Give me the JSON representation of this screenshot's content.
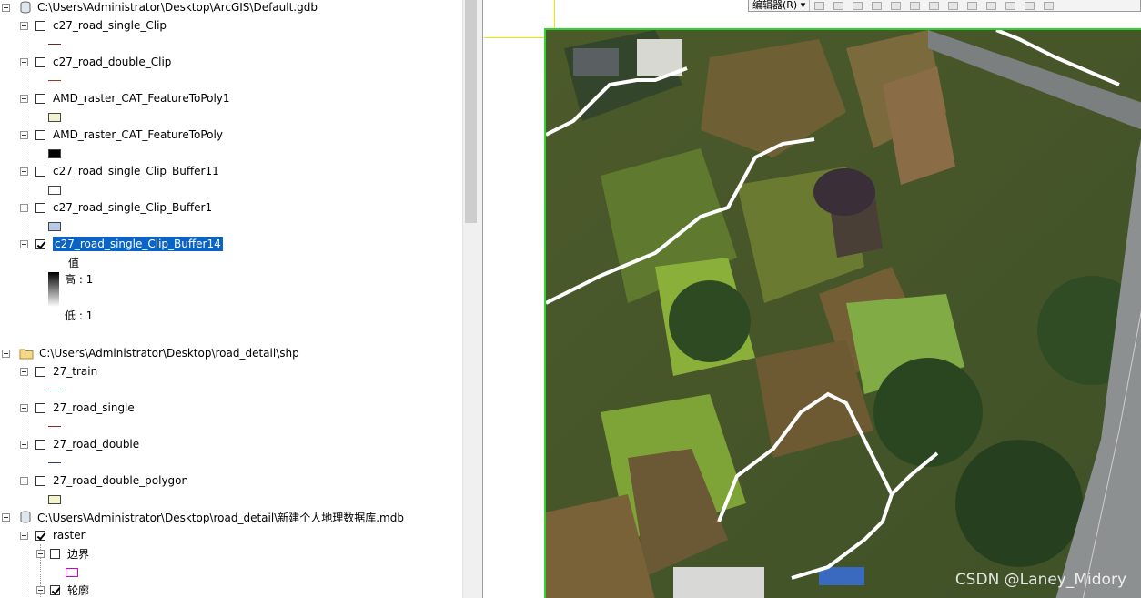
{
  "toc": {
    "groups": [
      {
        "path": "C:\\Users\\Administrator\\Desktop\\ArcGIS\\Default.gdb",
        "icon": "geodatabase-icon",
        "layers": [
          {
            "name": "c27_road_single_Clip",
            "checked": false,
            "symbol": "line",
            "color": "#6b2a1a"
          },
          {
            "name": "c27_road_double_Clip",
            "checked": false,
            "symbol": "line",
            "color": "#9b3b1a"
          },
          {
            "name": "AMD_raster_CAT_FeatureToPoly1",
            "checked": false,
            "symbol": "fill",
            "color": "#f3f2cf"
          },
          {
            "name": "AMD_raster_CAT_FeatureToPoly",
            "checked": false,
            "symbol": "fill",
            "color": "#000000"
          },
          {
            "name": "c27_road_single_Clip_Buffer11",
            "checked": false,
            "symbol": "fill",
            "color": "#ffffff"
          },
          {
            "name": "c27_road_single_Clip_Buffer1",
            "checked": false,
            "symbol": "fill",
            "color": "#b9cbea"
          },
          {
            "name": "c27_road_single_Clip_Buffer14",
            "checked": true,
            "selected": true,
            "symbol": "raster"
          }
        ],
        "raster_legend": {
          "field": "值",
          "high": "高 : 1",
          "low": "低 : 1"
        }
      },
      {
        "path": "C:\\Users\\Administrator\\Desktop\\road_detail\\shp",
        "icon": "folder-icon",
        "layers": [
          {
            "name": "27_train",
            "checked": false,
            "symbol": "line",
            "color": "#1c6b6b"
          },
          {
            "name": "27_road_single",
            "checked": false,
            "symbol": "line",
            "color": "#8b2a2a"
          },
          {
            "name": "27_road_double",
            "checked": false,
            "symbol": "line",
            "color": "#2a3a7a"
          },
          {
            "name": "27_road_double_polygon",
            "checked": false,
            "symbol": "fill",
            "color": "#f6f3c8"
          }
        ]
      },
      {
        "path": "C:\\Users\\Administrator\\Desktop\\road_detail\\新建个人地理数据库.mdb",
        "icon": "geodatabase-icon",
        "layers": [
          {
            "name": "raster",
            "checked": true
          },
          {
            "name": "边界",
            "checked": false,
            "symbol": "fill",
            "color": "#ffffff",
            "outline": "#d000d0"
          },
          {
            "name": "轮廓",
            "checked": true
          }
        ]
      }
    ]
  },
  "editor_toolbar": {
    "label": "编辑器(R) ▾"
  },
  "watermark": "CSDN @Laney_Midory"
}
